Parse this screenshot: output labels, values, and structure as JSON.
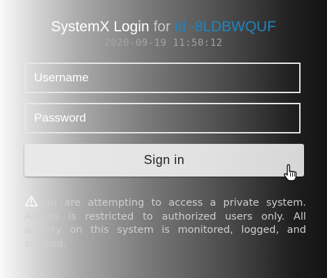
{
  "login": {
    "title_app": "SystemX Login",
    "title_for": "for",
    "title_id": "id -8LDBWQUF",
    "timestamp": "2020-09-19  11:50:12",
    "username_placeholder": "Username",
    "password_placeholder": "Password",
    "sign_in_label": "Sign in",
    "warning_text": "You are attempting to access a private system. Access is restricted to authorized users only. All activity on this system is monitored, logged, and audited.",
    "warning_icon": "warning-triangle-icon",
    "cursor_icon": "hand-pointer-icon"
  },
  "colors": {
    "id_accent": "#1f84bf",
    "button_bg": "#e2e2e2",
    "field_border": "#e6e6e6"
  }
}
